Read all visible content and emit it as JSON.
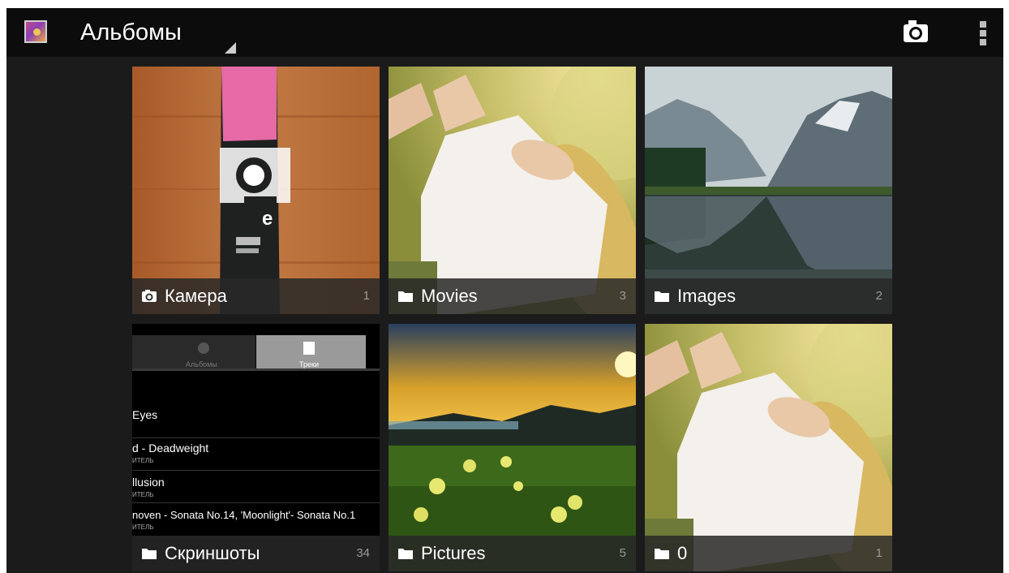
{
  "actionbar": {
    "title": "Альбомы",
    "icons": [
      "gallery-app-icon",
      "dropdown-arrow-icon",
      "camera-icon",
      "overflow-menu-icon"
    ]
  },
  "albums": [
    {
      "name": "Камера",
      "count": "1",
      "icon": "camera-icon"
    },
    {
      "name": "Movies",
      "count": "3",
      "icon": "folder-icon"
    },
    {
      "name": "Images",
      "count": "2",
      "icon": "folder-icon"
    },
    {
      "name": "Скриншоты",
      "count": "34",
      "icon": "folder-icon"
    },
    {
      "name": "Pictures",
      "count": "5",
      "icon": "folder-icon"
    },
    {
      "name": "0",
      "count": "1",
      "icon": "folder-icon"
    }
  ],
  "screenshot_thumb": {
    "tabs": [
      "Альбомы",
      "Треки"
    ],
    "tracks": [
      {
        "title": "Eyes",
        "sub": ""
      },
      {
        "title": "d - Deadweight",
        "sub": "ИТЕЛЬ"
      },
      {
        "title": "llusion",
        "sub": "ИТЕЛЬ"
      },
      {
        "title": "noven - Sonata No.14, 'Moonlight'- Sonata No.1",
        "sub": "ИТЕЛЬ"
      }
    ]
  },
  "colors": {
    "actionbar": "#0c0c0c",
    "background": "#1b1b1b",
    "caption_bg": "#282828"
  }
}
